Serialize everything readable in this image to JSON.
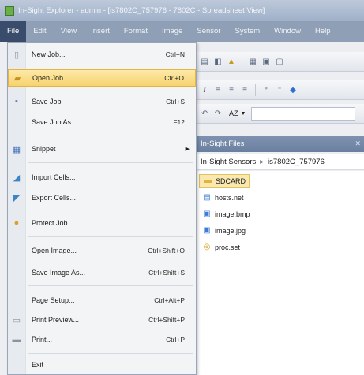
{
  "titlebar": {
    "title": "In-Sight Explorer - admin - [is7802C_757976 - 7802C - Spreadsheet View]"
  },
  "menubar": {
    "items": [
      {
        "label": "File",
        "active": true
      },
      {
        "label": "Edit"
      },
      {
        "label": "View"
      },
      {
        "label": "Insert"
      },
      {
        "label": "Format"
      },
      {
        "label": "Image"
      },
      {
        "label": "Sensor"
      },
      {
        "label": "System"
      },
      {
        "label": "Window"
      },
      {
        "label": "Help"
      }
    ]
  },
  "file_menu": {
    "items": [
      {
        "label": "New Job...",
        "shortcut": "Ctrl+N",
        "icon": "new-job-icon"
      },
      {
        "label": "Open Job...",
        "shortcut": "Ctrl+O",
        "icon": "open-folder-icon",
        "highlighted": true
      },
      {
        "label": "Save Job",
        "shortcut": "Ctrl+S",
        "icon": "save-icon"
      },
      {
        "label": "Save Job As...",
        "shortcut": "F12"
      },
      {
        "label": "Snippet",
        "has_submenu": true,
        "icon": "snippet-icon"
      },
      {
        "label": "Import Cells...",
        "icon": "import-cells-icon"
      },
      {
        "label": "Export Cells...",
        "icon": "export-cells-icon"
      },
      {
        "label": "Protect Job...",
        "icon": "lock-icon"
      },
      {
        "label": "Open Image...",
        "shortcut": "Ctrl+Shift+O"
      },
      {
        "label": "Save Image As...",
        "shortcut": "Ctrl+Shift+S"
      },
      {
        "label": "Page Setup...",
        "shortcut": "Ctrl+Alt+P"
      },
      {
        "label": "Print Preview...",
        "shortcut": "Ctrl+Shift+P",
        "icon": "print-preview-icon"
      },
      {
        "label": "Print...",
        "shortcut": "Ctrl+P",
        "icon": "printer-icon"
      },
      {
        "label": "Exit"
      }
    ]
  },
  "formula_bar": {
    "cell_ref_prefix": "AZ"
  },
  "insight_files": {
    "title": "In-Sight Files",
    "breadcrumb": [
      "In-Sight Sensors",
      "is7802C_757976"
    ],
    "files": [
      {
        "name": "SDCARD",
        "icon": "folder-icon",
        "selected": true
      },
      {
        "name": "hosts.net",
        "icon": "net-file-icon"
      },
      {
        "name": "image.bmp",
        "icon": "image-file-icon"
      },
      {
        "name": "image.jpg",
        "icon": "image-file-icon"
      },
      {
        "name": "proc.set",
        "icon": "settings-file-icon"
      }
    ]
  },
  "colors": {
    "titlebar": "#a9b8cd",
    "menubar": "#8f9fb6",
    "menu_highlight": "#f7d36f",
    "selection": "#f9e9b0"
  }
}
